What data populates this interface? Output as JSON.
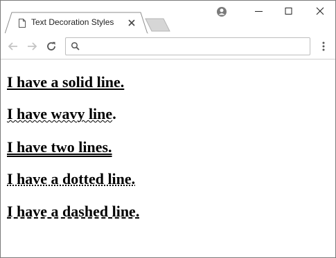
{
  "browser": {
    "tab_title": "Text Decoration Styles",
    "address_value": "",
    "icons": {
      "tab": "document-icon",
      "close_tab": "close-icon",
      "new_tab": "new-tab-icon",
      "profile": "profile-icon",
      "back": "back-arrow-icon",
      "forward": "forward-arrow-icon",
      "reload": "reload-icon",
      "search": "search-icon",
      "menu": "menu-dots-icon"
    }
  },
  "page": {
    "lines": [
      "I have a solid line.",
      "I have wavy line",
      "I have two lines.",
      "I have a dotted line.",
      "I have a dashed line."
    ],
    "wavy_suffix": "."
  }
}
